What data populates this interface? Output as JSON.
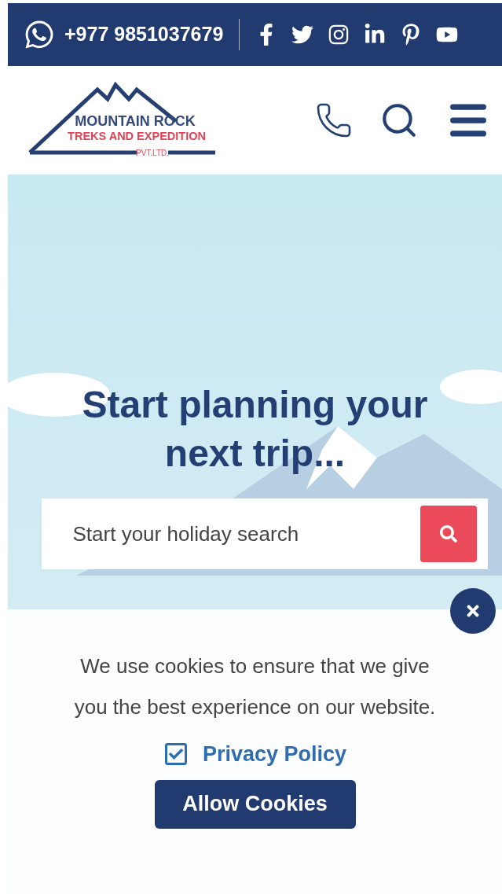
{
  "top_bar": {
    "phone": "+977 9851037679"
  },
  "header": {
    "logo": {
      "line_1": "MOUNTAIN ROCK",
      "line_2": "TREKS AND EXPEDITION",
      "line_3": "PVT.LTD."
    }
  },
  "hero": {
    "heading": "Start planning your next trip...",
    "search": {
      "placeholder": "Start your holiday search"
    }
  },
  "cookie_notice": {
    "message": "We use cookies to ensure that we give you the best experience on our website.",
    "privacy": {
      "label": "Privacy Policy",
      "checked": true
    },
    "button": "Allow Cookies"
  }
}
